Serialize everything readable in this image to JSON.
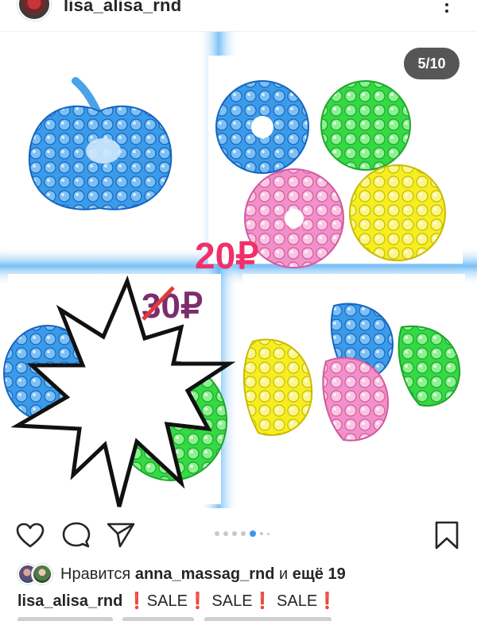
{
  "header": {
    "username": "lisa_alisa_rnd",
    "more_icon": "more-vertical-icon"
  },
  "post": {
    "counter": "5/10",
    "price_new": "20₽",
    "price_old": "30₽"
  },
  "actions": {
    "like_icon": "heart-icon",
    "comment_icon": "comment-icon",
    "share_icon": "send-icon",
    "save_icon": "bookmark-icon",
    "carousel_dots_total": 6,
    "carousel_dot_active": 5
  },
  "likes": {
    "prefix": "Нравится",
    "user": "anna_massag_rnd",
    "middle": "и",
    "rest": "ещё 19"
  },
  "caption": {
    "author": "lisa_alisa_rnd",
    "text": "SALE",
    "mark_color": "#e0173e"
  },
  "colors": {
    "blue": "#1e88e5",
    "green": "#3ee04a",
    "pink": "#f28dc6",
    "yellow": "#f5ec1c",
    "price_red": "#f0306a",
    "price_old": "#7b2d6d"
  }
}
